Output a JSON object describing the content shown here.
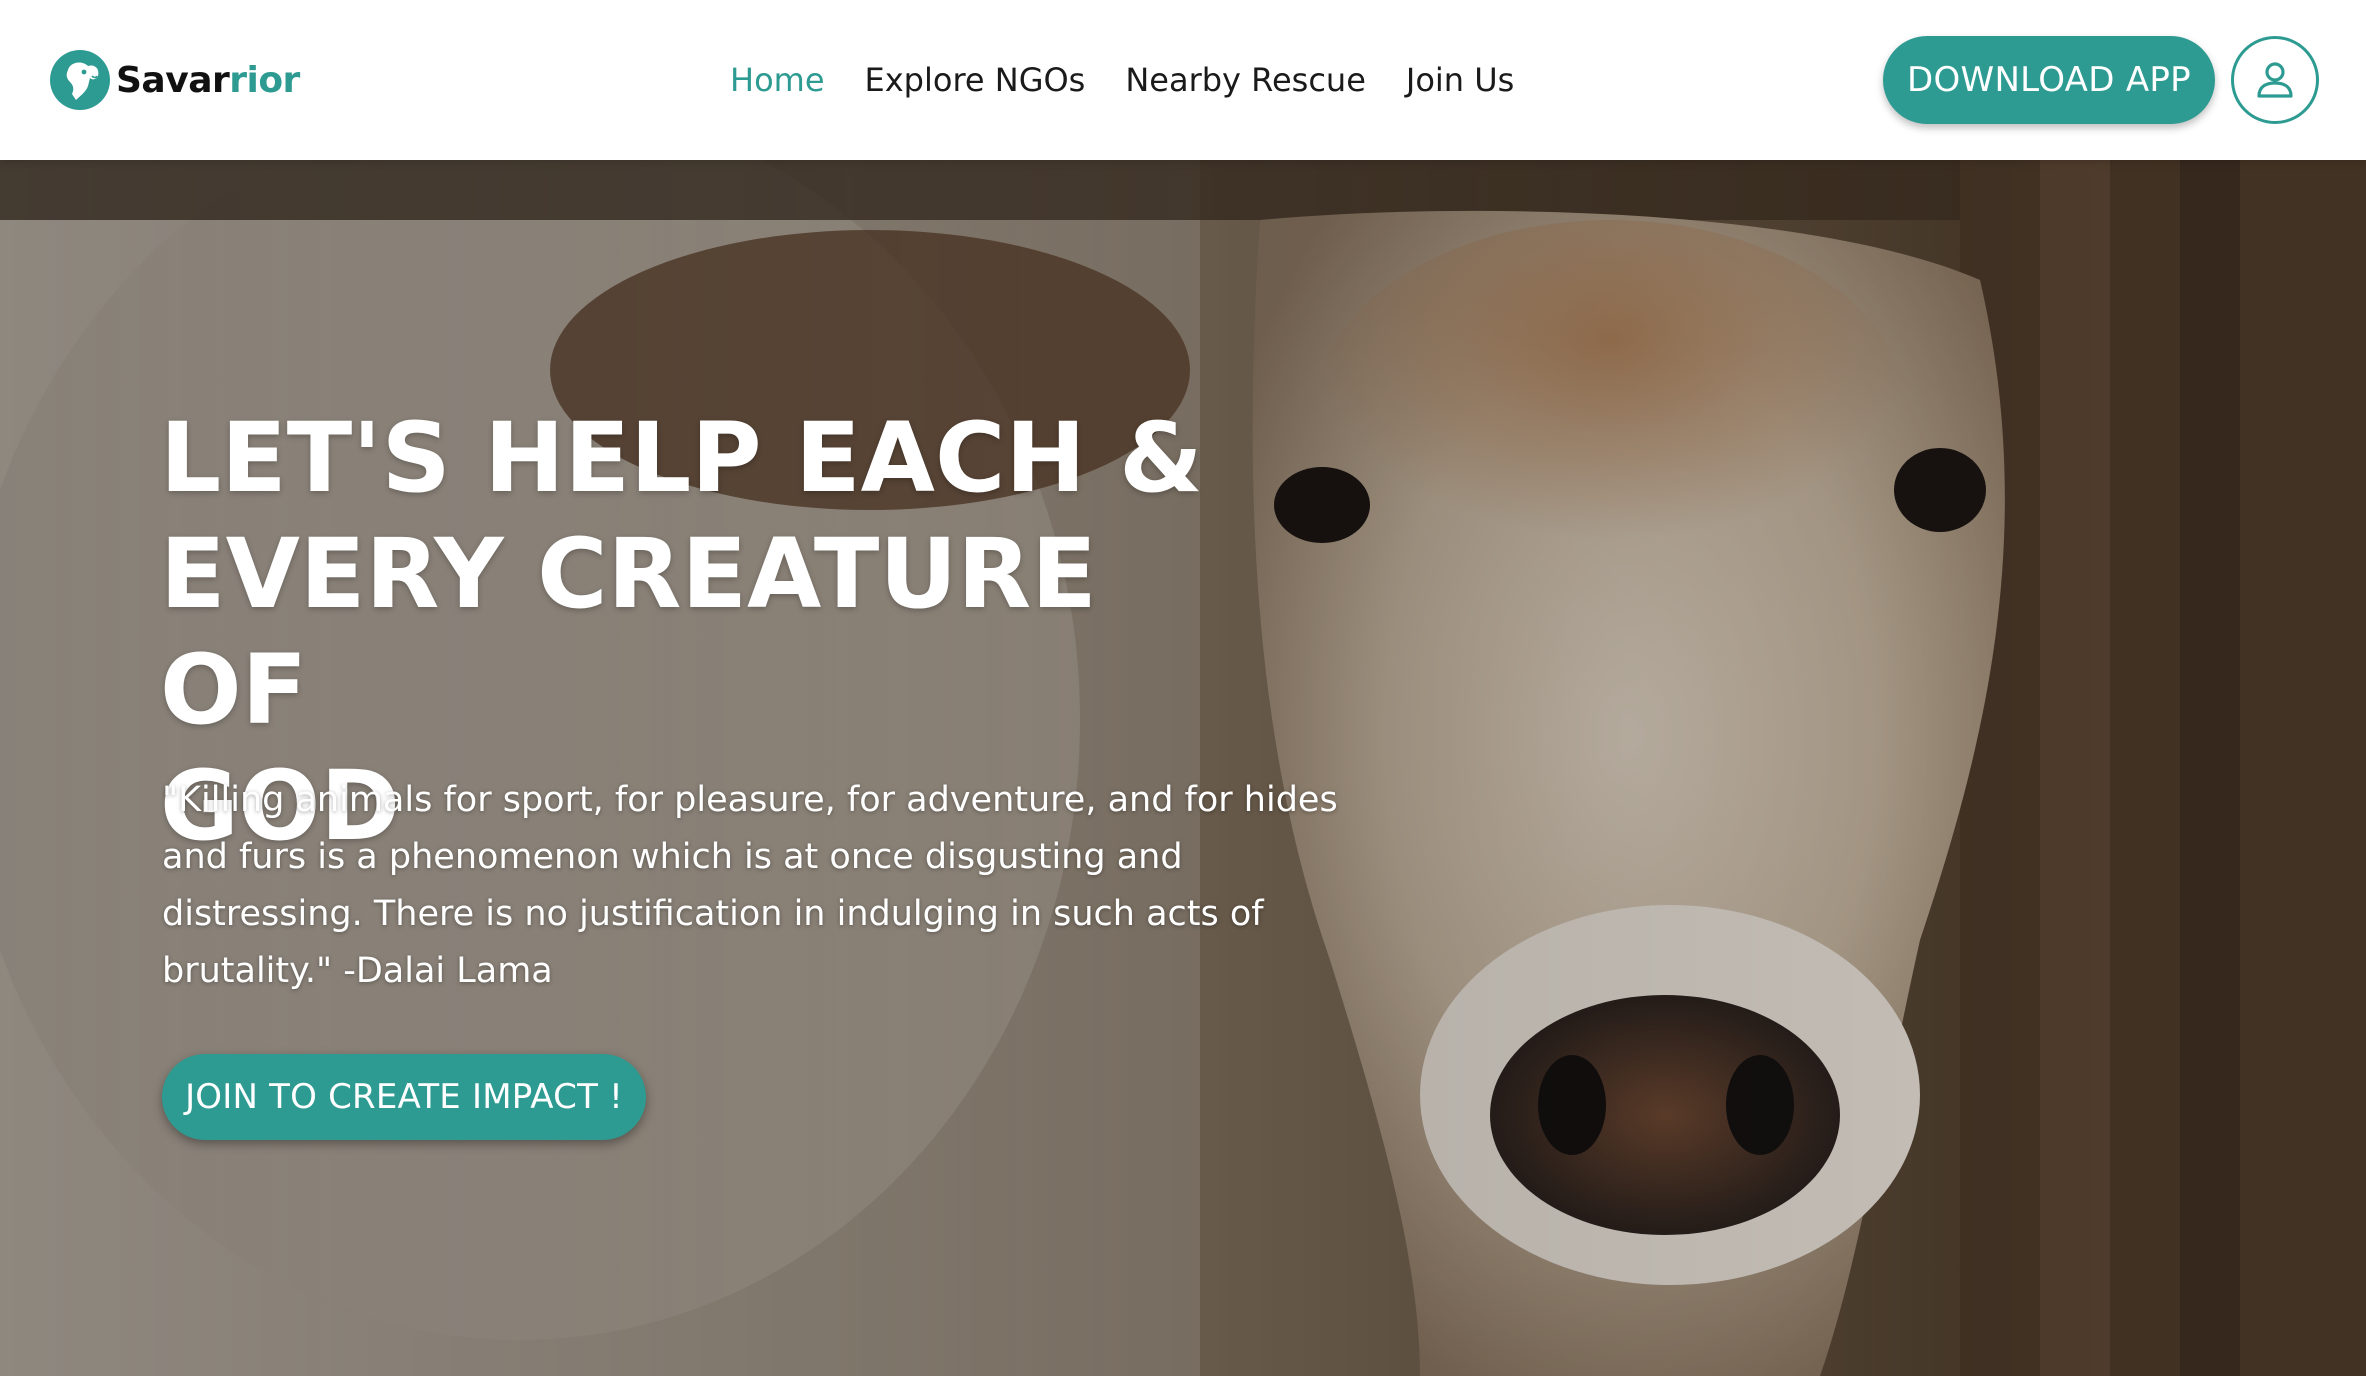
{
  "brand": {
    "name_part1": "Savar",
    "name_part2": "rior",
    "logo_icon": "dog-head-logo-icon",
    "accent_color": "#2e9b92"
  },
  "nav": {
    "items": [
      {
        "label": "Home",
        "active": true
      },
      {
        "label": "Explore NGOs",
        "active": false
      },
      {
        "label": "Nearby Rescue",
        "active": false
      },
      {
        "label": "Join Us",
        "active": false
      }
    ]
  },
  "header": {
    "download_label": "DOWNLOAD APP",
    "profile_icon": "user-profile-icon"
  },
  "hero": {
    "title_line1": "LET'S HELP EACH &",
    "title_line2": "EVERY CREATURE OF",
    "title_line3": "GOD",
    "quote": "\"Killing animals for sport, for pleasure, for adventure, and for hides and furs is a phenomenon which is at once disgusting and distressing. There is no justification in indulging in such acts of brutality.\" -Dalai Lama",
    "cta_label": "JOIN TO CREATE IMPACT !",
    "background_subject": "calf-face-photo"
  }
}
